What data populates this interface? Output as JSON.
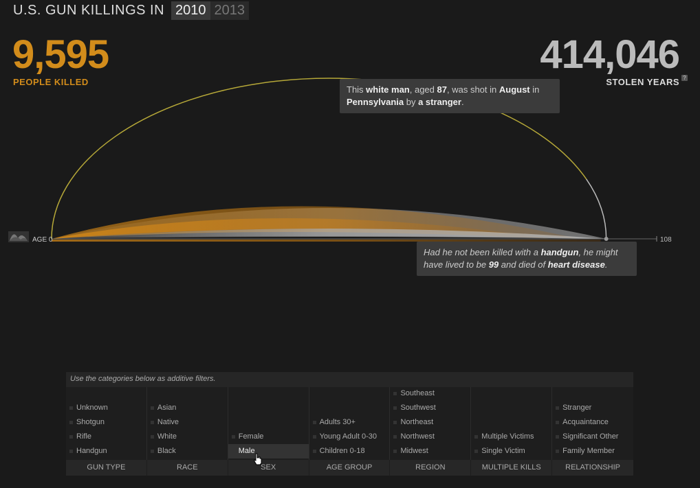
{
  "header": {
    "title": "U.S. GUN KILLINGS IN",
    "years": [
      {
        "label": "2010",
        "active": true
      },
      {
        "label": "2013",
        "active": false
      }
    ]
  },
  "stats": {
    "people_killed": "9,595",
    "people_killed_label": "PEOPLE KILLED",
    "stolen_years": "414,046",
    "stolen_years_label": "STOLEN YEARS",
    "help_glyph": "?"
  },
  "chart_data": {
    "type": "area",
    "title": "",
    "xlabel": "",
    "ylabel": "",
    "xlim": [
      0,
      108
    ],
    "axis_start_label": "AGE 0",
    "axis_end_label": "108",
    "highlight": {
      "age_killed": 87,
      "age_expected": 99
    },
    "colors": {
      "killed": "#f08c10",
      "stolen": "#bfbfbf",
      "highlight_killed": "#b6a838",
      "highlight_stolen": "#bbbbbb"
    }
  },
  "tooltip_top": {
    "p1": "This ",
    "b1": "white man",
    "p2": ", aged ",
    "b2": "87",
    "p3": ", was shot in ",
    "b3": "August",
    "p4": " in ",
    "b4": "Pennsylvania",
    "p5": " by ",
    "b5": "a stranger",
    "p6": "."
  },
  "tooltip_bottom": {
    "p1": "Had he not been killed with a ",
    "b1": "handgun",
    "p2": ", he might have lived to be ",
    "b2": "99",
    "p3": " and died of ",
    "b3": "heart disease",
    "p4": "."
  },
  "filters": {
    "note": "Use the categories below as additive filters.",
    "groups": [
      {
        "head": "GUN TYPE",
        "items": [
          "Unknown",
          "Shotgun",
          "Rifle",
          "Handgun"
        ]
      },
      {
        "head": "RACE",
        "items": [
          "Asian",
          "Native",
          "White",
          "Black"
        ]
      },
      {
        "head": "SEX",
        "items": [
          "Female",
          "Male"
        ]
      },
      {
        "head": "AGE GROUP",
        "items": [
          "Adults 30+",
          "Young Adult 0-30",
          "Children 0-18"
        ]
      },
      {
        "head": "REGION",
        "items": [
          "Southeast",
          "Southwest",
          "Northeast",
          "Northwest",
          "Midwest"
        ]
      },
      {
        "head": "MULTIPLE KILLS",
        "items": [
          "Multiple Victims",
          "Single Victim"
        ]
      },
      {
        "head": "RELATIONSHIP",
        "items": [
          "Stranger",
          "Acquaintance",
          "Significant Other",
          "Family Member"
        ]
      }
    ],
    "selected": "Male"
  }
}
